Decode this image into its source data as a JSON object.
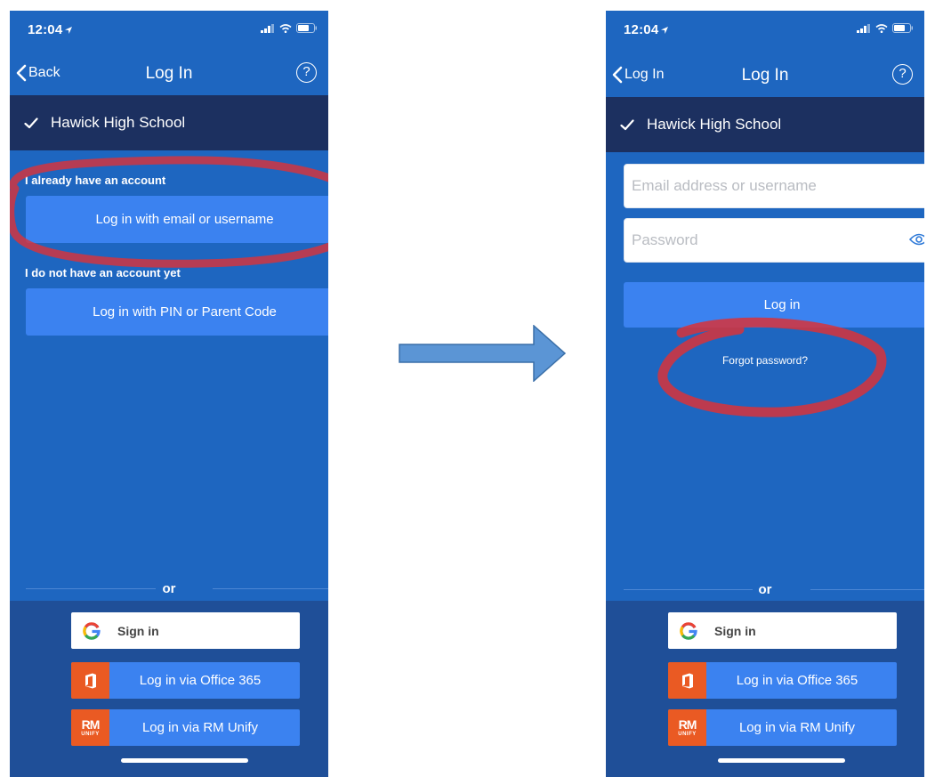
{
  "colors": {
    "phone_bg": "#1e66c0",
    "school_bar": "#1c3060",
    "button_blue": "#3b82f0",
    "bottom_panel": "#1f4f98",
    "annotation_red": "#d8333a",
    "arrow_fill": "#5b95d5",
    "office_orange": "#ea5a23"
  },
  "left_screen": {
    "status": {
      "time": "12:04"
    },
    "nav": {
      "back_label": "Back",
      "title": "Log In"
    },
    "school": {
      "name": "Hawick High School"
    },
    "existing_heading": "I already have an account",
    "email_button": "Log in with email or username",
    "new_heading": "I do not have an account yet",
    "pin_button": "Log in with PIN or Parent Code",
    "or_text": "or",
    "google_label": "Sign in",
    "office_label": "Log in via Office 365",
    "rm_label": "Log in via RM Unify",
    "rm_logo": "RM",
    "rm_logo_sub": "UNIFY"
  },
  "right_screen": {
    "status": {
      "time": "12:04"
    },
    "nav": {
      "back_label": "Log In",
      "title": "Log In"
    },
    "school": {
      "name": "Hawick High School"
    },
    "email_placeholder": "Email address or username",
    "password_placeholder": "Password",
    "login_button": "Log in",
    "forgot_link": "Forgot password?",
    "or_text": "or",
    "google_label": "Sign in",
    "office_label": "Log in via Office 365",
    "rm_label": "Log in via RM Unify",
    "rm_logo": "RM",
    "rm_logo_sub": "UNIFY"
  }
}
